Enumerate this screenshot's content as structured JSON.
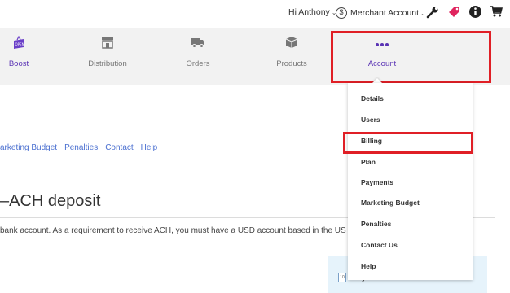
{
  "header": {
    "greeting": "Hi Anthony",
    "merchant_label": "Merchant Account",
    "icons": [
      "wrench-icon",
      "tag-icon",
      "info-icon",
      "cart-icon"
    ]
  },
  "nav": {
    "items": [
      {
        "label": "Boost",
        "icon": "boost-icon"
      },
      {
        "label": "Distribution",
        "icon": "distribution-icon"
      },
      {
        "label": "Orders",
        "icon": "orders-truck-icon"
      },
      {
        "label": "Products",
        "icon": "products-box-icon"
      },
      {
        "label": "Account",
        "icon": "ellipsis-icon",
        "active": true
      }
    ]
  },
  "subnav": {
    "links": [
      "arketing Budget",
      "Penalties",
      "Contact",
      "Help"
    ]
  },
  "main": {
    "heading": "–ACH deposit",
    "body": "bank account. As a requirement to receive ACH, you must have a USD account based in the US to collec"
  },
  "panel": {
    "label": "Paymerns"
  },
  "dropdown": {
    "items": [
      "Details",
      "Users",
      "Billing",
      "Plan",
      "Payments",
      "Marketing Budget",
      "Penalties",
      "Contact Us",
      "Help"
    ]
  },
  "colors": {
    "accent": "#5a33b4",
    "link": "#4a6fd0",
    "highlight_box": "#e01f26",
    "tag": "#e0245e",
    "panel_bg": "#e6f3fb"
  }
}
